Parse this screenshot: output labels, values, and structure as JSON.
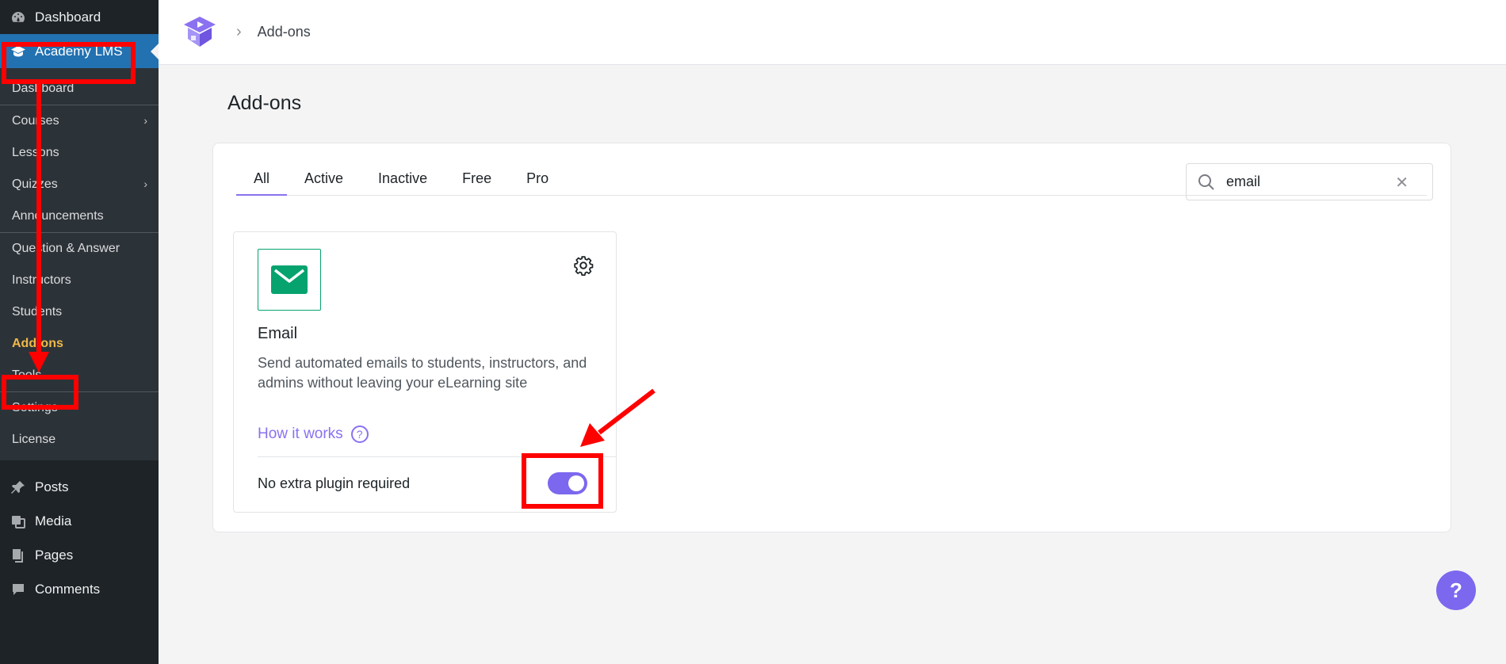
{
  "sidebar": {
    "top": [
      {
        "label": "Dashboard",
        "icon": "dashboard-icon"
      },
      {
        "label": "Academy LMS",
        "icon": "graduation-cap-icon"
      }
    ],
    "submenu": [
      {
        "label": "Dashboard"
      },
      {
        "label": "Courses",
        "has_children": true
      },
      {
        "label": "Lessons"
      },
      {
        "label": "Quizzes",
        "has_children": true
      },
      {
        "label": "Announcements"
      },
      {
        "label": "Question & Answer"
      },
      {
        "label": "Instructors"
      },
      {
        "label": "Students"
      },
      {
        "label": "Add-ons",
        "current": true
      },
      {
        "label": "Tools"
      },
      {
        "label": "Settings"
      },
      {
        "label": "License"
      }
    ],
    "bottom": [
      {
        "label": "Posts",
        "icon": "pin-icon"
      },
      {
        "label": "Media",
        "icon": "media-icon"
      },
      {
        "label": "Pages",
        "icon": "pages-icon"
      },
      {
        "label": "Comments",
        "icon": "comment-icon"
      }
    ]
  },
  "header": {
    "breadcrumb": "Add-ons"
  },
  "page": {
    "title": "Add-ons"
  },
  "tabs": [
    "All",
    "Active",
    "Inactive",
    "Free",
    "Pro"
  ],
  "search": {
    "value": "email",
    "clear_label": "✕"
  },
  "addon": {
    "name": "Email",
    "description": "Send automated emails to students, instructors, and admins without leaving your eLearning site",
    "how_it_works": "How it works",
    "requirement": "No extra plugin required",
    "enabled": true
  },
  "help_button": "?",
  "colors": {
    "sidebar_bg": "#1d2327",
    "active_menu": "#2271b1",
    "accent": "#7b68ee",
    "annotation": "#ff0000",
    "email_green": "#06a36f"
  }
}
